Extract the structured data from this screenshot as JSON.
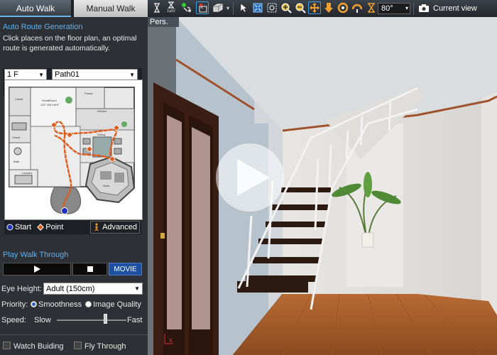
{
  "tabs": {
    "auto_walk": "Auto Walk",
    "manual_walk": "Manual Walk"
  },
  "toolbar": {
    "angle_value": "80°",
    "current_view_label": "Current view",
    "walk_icon_sub": "1⇄2"
  },
  "auto_route": {
    "title": "Auto Route Generation",
    "description_line1": "Click places on the floor plan, an optimal",
    "description_line2": "route is generated automatically.",
    "floor_select": "1 F",
    "path_select": "Path01"
  },
  "floor_plan": {
    "room_labels": [
      "Closet",
      "GreatRoom",
      "Pantry",
      "Kitchen",
      "Dining",
      "Laundry",
      "Closet",
      "Bath",
      "Nook"
    ],
    "dims_label": "13'3\" 18'6\"x16'6\""
  },
  "legend": {
    "start": "Start",
    "point": "Point",
    "advanced": "Advanced"
  },
  "play_walk": {
    "title": "Play Walk Through",
    "movie_label": "MOVIE"
  },
  "eye_height": {
    "label": "Eye Height:",
    "value": "Adult (150cm)"
  },
  "priority": {
    "label": "Priority:",
    "option1": "Smoothness",
    "option2": "Image Quality",
    "selected": "Smoothness"
  },
  "speed": {
    "label": "Speed:",
    "slow": "Slow",
    "fast": "Fast",
    "level": 0.55
  },
  "checkboxes": {
    "watch_building": "Watch Buiding",
    "fly_through": "Fly Through"
  },
  "viewport": {
    "tab_label": "Pers."
  },
  "colors": {
    "accent_blue": "#5fb0f0",
    "route_red": "#e05a1a",
    "start_blue": "#2030c0",
    "movie_blue": "#1f4fa0"
  }
}
